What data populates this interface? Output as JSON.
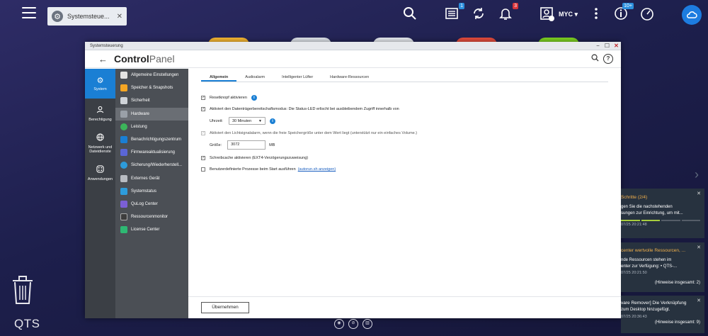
{
  "taskbar": {
    "task_tab_label": "Systemsteue...",
    "task_tab_close": "✕",
    "user_label": "MYC ▾",
    "badges": {
      "news": "1",
      "notifications": "3",
      "events": "10+"
    }
  },
  "window": {
    "title": "Systemsteuerung",
    "header_title_bold": "Control",
    "header_title_light": "Panel"
  },
  "rail": [
    {
      "label": "System",
      "icon": "gear-icon"
    },
    {
      "label": "Berechtigung",
      "icon": "user-icon"
    },
    {
      "label": "Netzwerk und Dateidienste",
      "icon": "globe-icon"
    },
    {
      "label": "Anwendungen",
      "icon": "apps-icon"
    }
  ],
  "submenu": [
    {
      "label": "Allgemeine Einstellungen",
      "color": "#e3e3e3"
    },
    {
      "label": "Speicher & Snapshots",
      "color": "#f5a623"
    },
    {
      "label": "Sicherheit",
      "color": "#cfd3d8"
    },
    {
      "label": "Hardware",
      "color": "#9aa0a8"
    },
    {
      "label": "Leistung",
      "color": "#3cb55a"
    },
    {
      "label": "Benachrichtigungszentrum",
      "color": "#1a7fd4"
    },
    {
      "label": "Firmwareaktualisierung",
      "color": "#5a66d6"
    },
    {
      "label": "Sicherung/Wiederherstell...",
      "color": "#2d9cdb"
    },
    {
      "label": "Externes Gerät",
      "color": "#b8bcc2"
    },
    {
      "label": "Systemstatus",
      "color": "#2d9cdb"
    },
    {
      "label": "QuLog Center",
      "color": "#7b5fd6"
    },
    {
      "label": "Ressourcenmonitor",
      "color": "#3d3d3d"
    },
    {
      "label": "License Center",
      "color": "#2eb873"
    }
  ],
  "tabs": [
    "Allgemein",
    "Audioalarm",
    "Intelligenter Lüfter",
    "Hardware-Ressourcen"
  ],
  "options": {
    "reset": "Resetknopf aktivieren",
    "standby": "Aktiviert den Datenträgerbereitschaftsmodus: Die Status-LED erlischt bei ausbleibendem Zugriff innerhalb von",
    "time_label": "Uhrzeit:",
    "time_value": "30 Minuten",
    "light_alarm": "Aktiviert den Lichtsignalalarm, wenn die freie Speichergröße unter dem Wert liegt (unterstützt nur ein einfaches Volume.)",
    "size_label": "Größe:",
    "size_value": "3072",
    "size_unit": "MB",
    "write_cache": "Schreibcache aktivieren (EXT4-Verzögerungszuweisung)",
    "custom_proc": "Benutzerdefinierte Prozesse beim Start ausführen",
    "custom_link": "(autorun.sh anzeigen)",
    "apply": "Übernehmen"
  },
  "checkbox_states": {
    "reset": true,
    "standby": true,
    "light_alarm": true,
    "write_cache": true,
    "custom_proc": false
  },
  "desktop": {
    "brand": "QTS"
  },
  "notifications": [
    {
      "title": "Schritte (2/4)",
      "body1": "gen Sie die nachstehenden",
      "body2": "sungen zur Einrichtung, um mit...",
      "time": "07/25 20:21:48",
      "count": ""
    },
    {
      "title": "center wertvolle Ressourcen, ...",
      "body1": "nde Ressourcen stehen im",
      "body2": "enter zur Verfügung: • QTS-...",
      "time": "07/25 20:21:50",
      "count": "(Hinweise insgesamt: 2)"
    },
    {
      "title": "vare Remover] Die Verknüpfung",
      "body1": "zum Desktop hinzugefügt.",
      "body2": "",
      "time": "07/25 20:36:43",
      "count": "(Hinweise insgesamt: 9)"
    }
  ]
}
